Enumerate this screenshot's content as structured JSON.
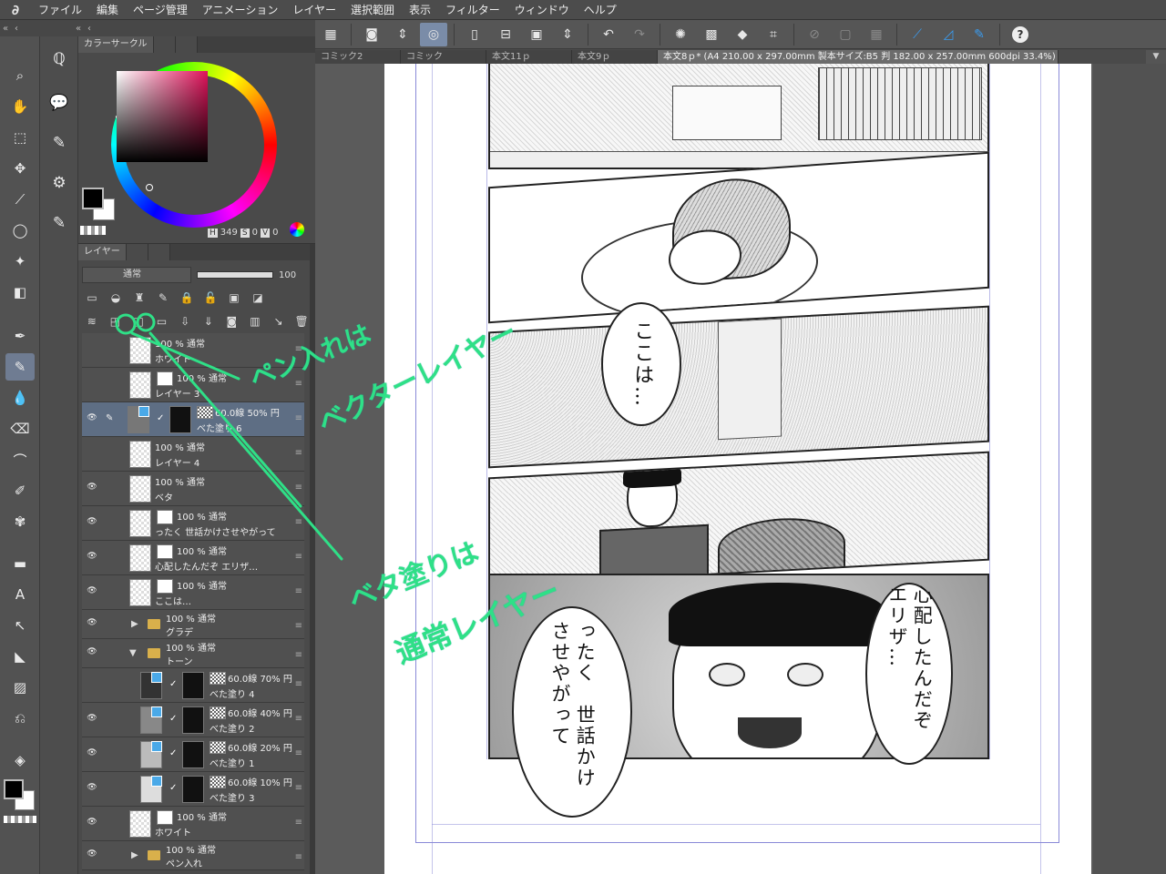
{
  "menubar": {
    "logo": "∂",
    "items": [
      "ファイル",
      "編集",
      "ページ管理",
      "アニメーション",
      "レイヤー",
      "選択範囲",
      "表示",
      "フィルター",
      "ウィンドウ",
      "ヘルプ"
    ]
  },
  "command_bar": {
    "icons": [
      "grid-icon",
      "camera-icon",
      "spinner-icon",
      "spiral-icon",
      "new-page-icon",
      "open-icon",
      "save-icon",
      "arrows-updown-icon",
      "undo-icon",
      "redo-icon",
      "spray-icon",
      "transform-icon",
      "fill-icon",
      "crop-icon",
      "diagonal-icon",
      "frame-icon",
      "grid2-icon",
      "ruler-icon",
      "perspective-icon",
      "pen-blue-icon",
      "help-icon"
    ],
    "help_label": "?"
  },
  "tabs": {
    "items": [
      "コミック2",
      "コミック",
      "本文11ｐ",
      "本文9ｐ"
    ],
    "active": "本文8ｐ* (A4 210.00 x 297.00mm 製本サイズ:B5 判 182.00 x 257.00mm 600dpi 33.4%)",
    "arrow": "▼"
  },
  "color_panel": {
    "tab_label": "カラーサークル",
    "h_label": "H",
    "h_value": "349",
    "s_label": "S",
    "s_value": "0",
    "v_label": "V",
    "v_value": "0",
    "main_color": "#000000",
    "sub_color": "#ffffff"
  },
  "layer_panel": {
    "tab_label": "レイヤー",
    "blend_mode": "通常",
    "opacity": "100",
    "layers": [
      {
        "percent": "100 % 通常",
        "name": "ホワイト",
        "visible": false
      },
      {
        "percent": "100 % 通常",
        "name": "レイヤー 3",
        "visible": false
      },
      {
        "percent": "60.0線 50% 円",
        "name": "べた塗り 6",
        "visible": true,
        "selected": true
      },
      {
        "percent": "100 % 通常",
        "name": "レイヤー 4",
        "visible": false
      },
      {
        "percent": "100 % 通常",
        "name": "ベタ",
        "visible": true
      },
      {
        "percent": "100 % 通常",
        "name": "ったく 世話かけさせやがって",
        "visible": true
      },
      {
        "percent": "100 % 通常",
        "name": "心配したんだぞ エリザ…",
        "visible": true
      },
      {
        "percent": "100 % 通常",
        "name": "ここは…",
        "visible": true
      },
      {
        "percent": "100 % 通常",
        "name": "グラデ",
        "visible": true
      },
      {
        "percent": "100 % 通常",
        "name": "トーン",
        "visible": true
      },
      {
        "percent": "60.0線 70% 円",
        "name": "べた塗り 4",
        "visible": false
      },
      {
        "percent": "60.0線 40% 円",
        "name": "べた塗り 2",
        "visible": true
      },
      {
        "percent": "60.0線 20% 円",
        "name": "べた塗り 1",
        "visible": true
      },
      {
        "percent": "60.0線 10% 円",
        "name": "べた塗り 3",
        "visible": true
      },
      {
        "percent": "100 % 通常",
        "name": "ホワイト",
        "visible": true
      },
      {
        "percent": "100 % 通常",
        "name": "ペン入れ",
        "visible": true
      }
    ]
  },
  "manga": {
    "bubble1": "ここは…",
    "bubble2": "心配したんだぞ　エリザ…",
    "bubble3": "ったく　世話かけさせやがって"
  },
  "annotations": {
    "line1a": "ペン入れは",
    "line1b": "ベクターレイヤー",
    "line2a": "ベタ塗りは",
    "line2b": "通常レイヤー",
    "color": "#2fe087"
  }
}
